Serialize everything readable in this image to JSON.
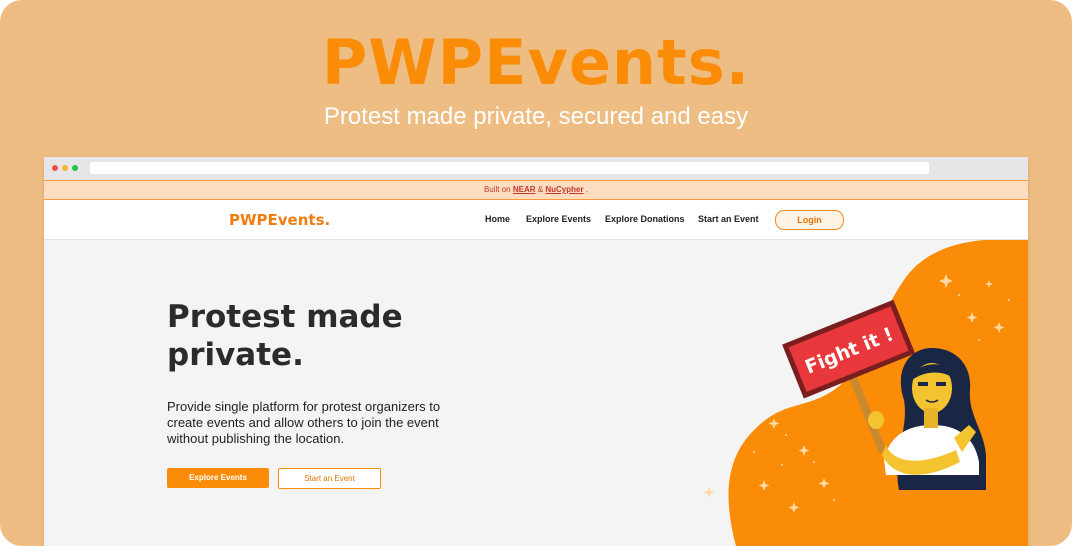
{
  "promo": {
    "title": "PWPEvents.",
    "subtitle": "Protest made private, secured and easy"
  },
  "banner": {
    "prefix": "Built on",
    "near": "NEAR",
    "amp": "&",
    "nucypher": "NuCypher",
    "suffix": "."
  },
  "nav": {
    "logo": "PWPEvents.",
    "links": [
      "Home",
      "Explore Events",
      "Explore Donations",
      "Start an Event"
    ],
    "login": "Login"
  },
  "hero": {
    "title": "Protest made private.",
    "description": "Provide single platform for protest organizers to create events and allow others to join the event without publishing the location.",
    "primary_button": "Explore Events",
    "secondary_button": "Start an Event"
  },
  "illustration": {
    "sign_text": "Fight it !"
  },
  "colors": {
    "background": "#eebd83",
    "accent": "#fb8c07",
    "banner_bg": "#fddcbf",
    "sign_red": "#e8383b"
  },
  "icons": {
    "window_controls": [
      "close-dot",
      "minimize-dot",
      "maximize-dot"
    ]
  }
}
